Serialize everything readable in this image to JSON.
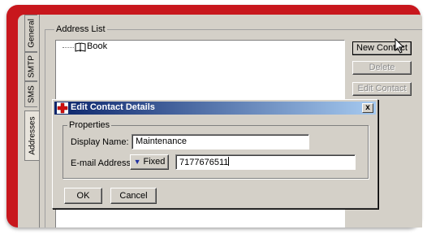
{
  "tabs": [
    {
      "label": "General",
      "active": false
    },
    {
      "label": "SMTP",
      "active": false
    },
    {
      "label": "SMS",
      "active": false
    },
    {
      "label": "Addresses",
      "active": true
    }
  ],
  "address_list": {
    "title": "Address List",
    "tree_root": "Book",
    "buttons": {
      "new_contact": "New Contact",
      "delete": "Delete",
      "edit_contact": "Edit Contact"
    }
  },
  "dialog": {
    "title": "Edit Contact Details",
    "close": "x",
    "properties_title": "Properties",
    "display_name_label": "Display Name:",
    "display_name_value": "Maintenance",
    "email_label": "E-mail Address:",
    "email_type": "Fixed",
    "email_value": "7177676511",
    "ok": "OK",
    "cancel": "Cancel"
  },
  "colors": {
    "frame": "#c8171d",
    "titlebar_start": "#0a246a",
    "titlebar_end": "#a6caf0"
  }
}
